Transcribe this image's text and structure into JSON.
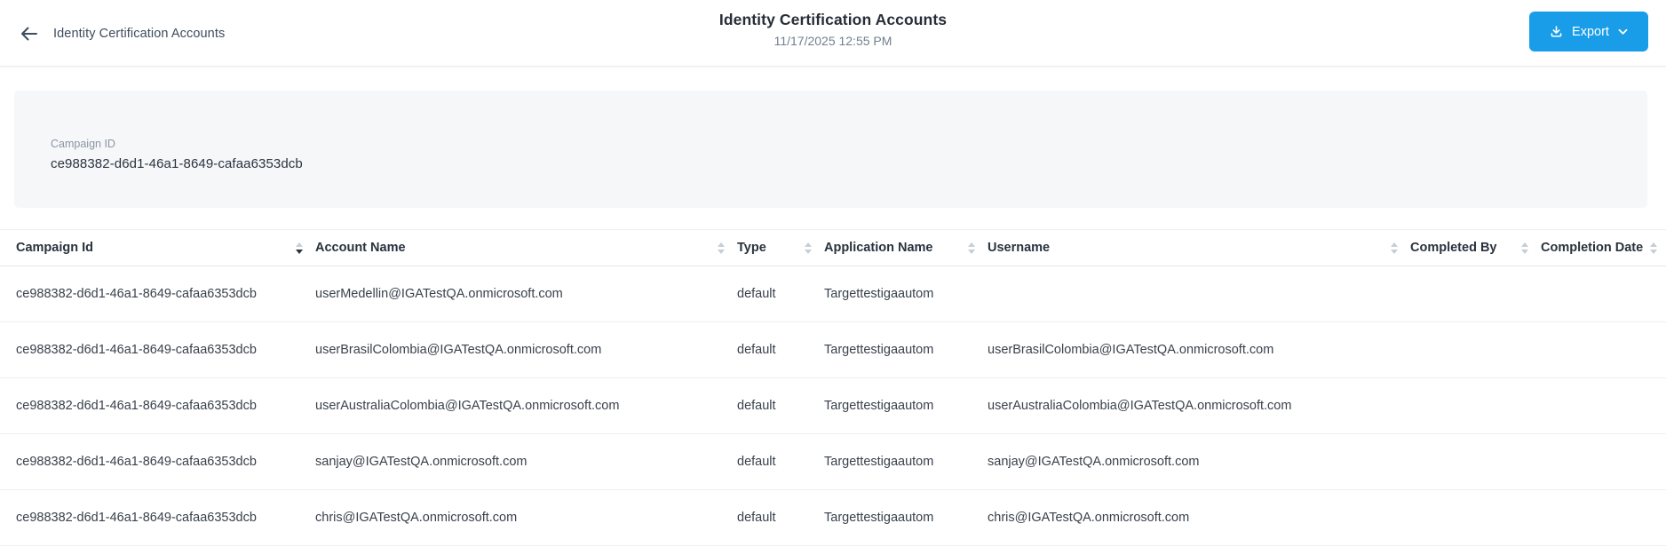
{
  "header": {
    "back_label": "Identity Certification Accounts",
    "title": "Identity Certification Accounts",
    "timestamp": "11/17/2025 12:55 PM",
    "export_label": "Export"
  },
  "campaign_panel": {
    "label": "Campaign ID",
    "value": "ce988382-d6d1-46a1-8649-cafaa6353dcb"
  },
  "table": {
    "columns": [
      {
        "label": "Campaign Id",
        "sort": "desc"
      },
      {
        "label": "Account Name",
        "sort": "none"
      },
      {
        "label": "Type",
        "sort": "none"
      },
      {
        "label": "Application Name",
        "sort": "none"
      },
      {
        "label": "Username",
        "sort": "none"
      },
      {
        "label": "Completed By",
        "sort": "none"
      },
      {
        "label": "Completion Date",
        "sort": "none"
      }
    ],
    "rows": [
      [
        "ce988382-d6d1-46a1-8649-cafaa6353dcb",
        "userMedellin@IGATestQA.onmicrosoft.com",
        "default",
        "Targettestigaautom",
        "",
        "",
        ""
      ],
      [
        "ce988382-d6d1-46a1-8649-cafaa6353dcb",
        "userBrasilColombia@IGATestQA.onmicrosoft.com",
        "default",
        "Targettestigaautom",
        "userBrasilColombia@IGATestQA.onmicrosoft.com",
        "",
        ""
      ],
      [
        "ce988382-d6d1-46a1-8649-cafaa6353dcb",
        "userAustraliaColombia@IGATestQA.onmicrosoft.com",
        "default",
        "Targettestigaautom",
        "userAustraliaColombia@IGATestQA.onmicrosoft.com",
        "",
        ""
      ],
      [
        "ce988382-d6d1-46a1-8649-cafaa6353dcb",
        "sanjay@IGATestQA.onmicrosoft.com",
        "default",
        "Targettestigaautom",
        "sanjay@IGATestQA.onmicrosoft.com",
        "",
        ""
      ],
      [
        "ce988382-d6d1-46a1-8649-cafaa6353dcb",
        "chris@IGATestQA.onmicrosoft.com",
        "default",
        "Targettestigaautom",
        "chris@IGATestQA.onmicrosoft.com",
        "",
        ""
      ]
    ]
  },
  "colors": {
    "accent": "#1a9de9",
    "panel_bg": "#f6f7f9",
    "row_border": "#ebf0f6",
    "text_dark": "#2a323d"
  }
}
